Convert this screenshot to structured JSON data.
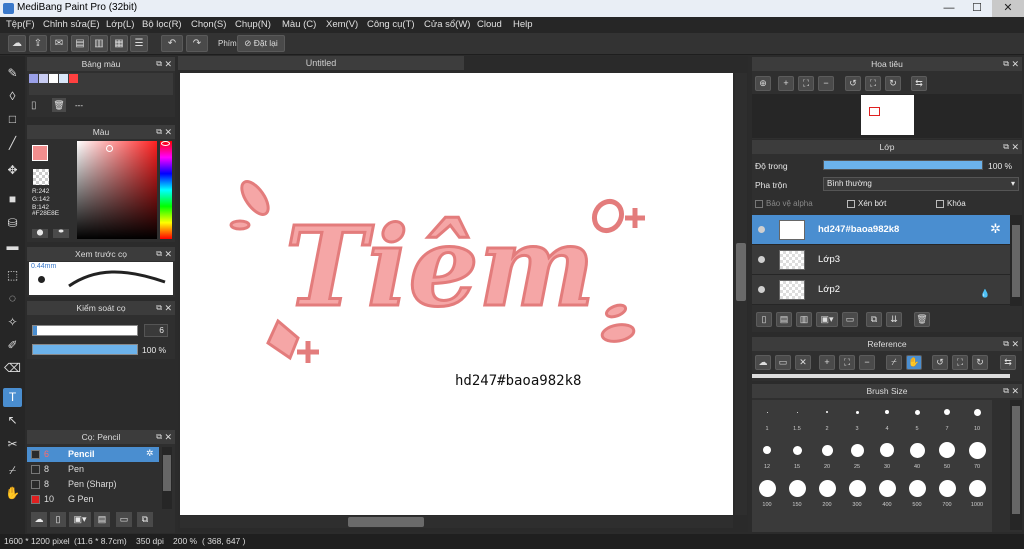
{
  "window": {
    "title": "MediBang Paint Pro (32bit)",
    "min": "—",
    "max": "☐",
    "close": "✕"
  },
  "menu": [
    "Tệp(F)",
    "Chỉnh sửa(E)",
    "Lớp(L)",
    "Bộ lọc(R)",
    "Chọn(S)",
    "Chụp(N)",
    "Màu (C)",
    "Xem(V)",
    "Công cụ(T)",
    "Cửa sổ(W)",
    "Cloud",
    "Help"
  ],
  "toolbar": {
    "key_label": "Phím",
    "reset_label": "Đặt lại"
  },
  "document": {
    "tab_title": "Untitled",
    "artwork_text": "Tiêm",
    "canvas_text": "hd247#baoa982k8"
  },
  "palette_panel": {
    "title": "Bảng màu",
    "dash": "---",
    "swatches": [
      "#9aa0e8",
      "#c8ccf2",
      "#ffffff",
      "#d8e6f8",
      "#ff4040"
    ]
  },
  "color_panel": {
    "title": "Màu",
    "r": "R:242",
    "g": "G:142",
    "b": "B:142",
    "hex": "#F28E8E",
    "main_color": "#f28e8e"
  },
  "brush_preview": {
    "title": "Xem trước cọ",
    "size": "0.44mm"
  },
  "brush_control": {
    "title": "Kiểm soát cọ",
    "size_value": "6",
    "opacity_value": "100 %",
    "size_fraction": 0.04,
    "opacity_fraction": 1.0
  },
  "brush_panel": {
    "title": "Cọ: Pencil",
    "items": [
      {
        "num": "6",
        "name": "Pencil",
        "selected": true,
        "color": "#2b2b2b"
      },
      {
        "num": "8",
        "name": "Pen",
        "selected": false,
        "color": "#2b2b2b"
      },
      {
        "num": "8",
        "name": "Pen (Sharp)",
        "selected": false,
        "color": "#2b2b2b"
      },
      {
        "num": "10",
        "name": "G Pen",
        "selected": false,
        "color": "#e02020"
      }
    ]
  },
  "navigator": {
    "title": "Hoa tiêu"
  },
  "layer_panel": {
    "title": "Lớp",
    "opacity_label": "Độ trong",
    "opacity_value": "100 %",
    "opacity_fraction": 1.0,
    "blend_label": "Pha trộn",
    "blend_value": "Bình thường",
    "protect_alpha": "Bảo vệ alpha",
    "clipping": "Xén bớt",
    "lock": "Khóa",
    "layers": [
      {
        "name": "hd247#baoa982k8",
        "selected": true
      },
      {
        "name": "Lớp3",
        "selected": false
      },
      {
        "name": "Lớp2",
        "selected": false
      }
    ]
  },
  "reference": {
    "title": "Reference"
  },
  "brush_size": {
    "title": "Brush Size",
    "sizes": [
      "1",
      "1.5",
      "2",
      "3",
      "4",
      "5",
      "7",
      "10",
      "12",
      "15",
      "20",
      "25",
      "30",
      "40",
      "50",
      "70",
      "100",
      "150",
      "200",
      "300",
      "400",
      "500",
      "700",
      "1000"
    ]
  },
  "status": {
    "dims": "1600 * 1200 pixel",
    "physical": "(11.6 * 8.7cm)",
    "dpi": "350 dpi",
    "zoom": "200 %",
    "coords": "( 368, 647 )"
  }
}
